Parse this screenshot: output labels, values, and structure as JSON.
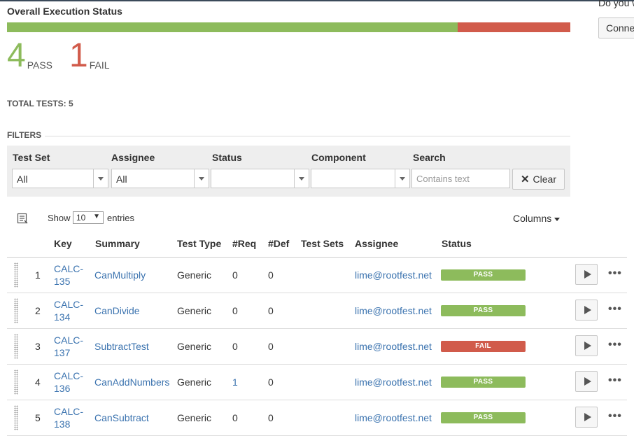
{
  "header": {
    "title": "Overall Execution Status"
  },
  "progress": {
    "pass_fraction": 0.8,
    "fail_fraction": 0.2
  },
  "summary": {
    "pass_count": "4",
    "pass_label": "PASS",
    "fail_count": "1",
    "fail_label": "FAIL",
    "total_label": "TOTAL TESTS: 5"
  },
  "filters": {
    "title": "FILTERS",
    "test_set": {
      "label": "Test Set",
      "value": "All"
    },
    "assignee": {
      "label": "Assignee",
      "value": "All"
    },
    "status": {
      "label": "Status",
      "value": ""
    },
    "component": {
      "label": "Component",
      "value": ""
    },
    "search": {
      "label": "Search",
      "placeholder": "Contains text",
      "value": ""
    },
    "clear_label": "Clear"
  },
  "table_controls": {
    "show_label": "Show",
    "entries_value": "10",
    "entries_label": "entries",
    "columns_label": "Columns"
  },
  "table": {
    "headers": [
      "Key",
      "Summary",
      "Test Type",
      "#Req",
      "#Def",
      "Test Sets",
      "Assignee",
      "Status"
    ],
    "rows": [
      {
        "num": "1",
        "key": "CALC-135",
        "summary": "CanMultiply",
        "type": "Generic",
        "req": "0",
        "def": "0",
        "assignee": "lime@rootfest.net",
        "status": "PASS"
      },
      {
        "num": "2",
        "key": "CALC-134",
        "summary": "CanDivide",
        "type": "Generic",
        "req": "0",
        "def": "0",
        "assignee": "lime@rootfest.net",
        "status": "PASS"
      },
      {
        "num": "3",
        "key": "CALC-137",
        "summary": "SubtractTest",
        "type": "Generic",
        "req": "0",
        "def": "0",
        "assignee": "lime@rootfest.net",
        "status": "FAIL"
      },
      {
        "num": "4",
        "key": "CALC-136",
        "summary": "CanAddNumbers",
        "type": "Generic",
        "req": "1",
        "def": "0",
        "assignee": "lime@rootfest.net",
        "status": "PASS"
      },
      {
        "num": "5",
        "key": "CALC-138",
        "summary": "CanSubtract",
        "type": "Generic",
        "req": "0",
        "def": "0",
        "assignee": "lime@rootfest.net",
        "status": "PASS"
      }
    ]
  },
  "side_panel": {
    "text": "Do you w",
    "button_label": "Conne"
  },
  "colors": {
    "pass": "#8dbb5c",
    "fail": "#d15b4b",
    "link": "#3b73af"
  }
}
